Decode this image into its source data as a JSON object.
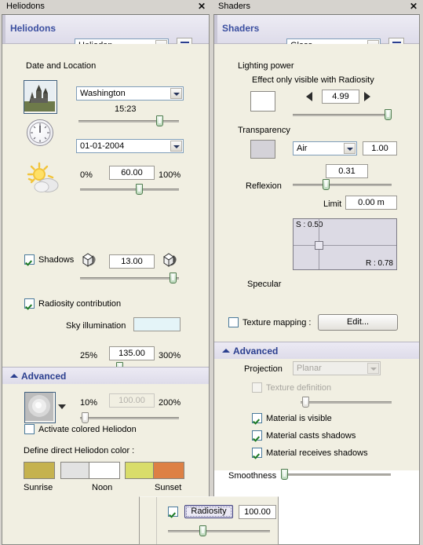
{
  "left_panel": {
    "title": "Heliodons",
    "close_label": "✕",
    "header_label": "Heliodons",
    "preset_combo_value": "Heliodon",
    "list_button_name": "list-view-button",
    "section_date_location": "Date and Location",
    "location_combo_value": "Washington",
    "time_value": "15:23",
    "date_combo_value": "01-01-2004",
    "sun_min_label": "0%",
    "sun_value": "60.00",
    "sun_max_label": "100%",
    "shadows_label": "Shadows",
    "shadows_value": "13.00",
    "radiosity_contribution_label": "Radiosity contribution",
    "sky_illumination_label": "Sky illumination",
    "sky_illumination_value": "",
    "sky_min_label": "25%",
    "sky_value": "135.00",
    "sky_max_label": "300%",
    "advanced_label": "Advanced",
    "adv_min_label": "10%",
    "adv_value": "100.00",
    "adv_max_label": "200%",
    "activate_colored_label": "Activate colored Heliodon",
    "define_color_label": "Define direct Heliodon color :",
    "swatches": [
      {
        "name": "sunrise",
        "color": "#c5b24e",
        "label": "Sunrise"
      },
      {
        "name": "mid-morning",
        "color": "#e2e2e2",
        "label": ""
      },
      {
        "name": "noon",
        "color": "#ffffff",
        "label": "Noon"
      },
      {
        "name": "afternoon",
        "color": "#d9dd6a",
        "label": ""
      },
      {
        "name": "sunset",
        "color": "#dd8044",
        "label": "Sunset"
      }
    ]
  },
  "right_panel": {
    "title": "Shaders",
    "close_label": "✕",
    "header_label": "Shaders",
    "shader_combo_value": "Glass",
    "lighting_power_label": "Lighting power",
    "lighting_hint_label": "Effect only visible with Radiosity",
    "lighting_color": "#ffffff",
    "lighting_value": "4.99",
    "transparency_label": "Transparency",
    "transparency_color": "#d4d2d8",
    "transparency_medium": "Air",
    "transparency_value": "1.00",
    "reflexion_label": "Reflexion",
    "reflexion_value": "0.31",
    "limit_label": "Limit",
    "limit_value": "0.00 m",
    "specular_label": "Specular",
    "specular_s_label": "S : 0.50",
    "specular_r_label": "R : 0.78",
    "texture_mapping_label": "Texture mapping :",
    "edit_button_label": "Edit...",
    "advanced_label": "Advanced",
    "projection_label": "Projection",
    "projection_value": "Planar",
    "texture_definition_label": "Texture definition",
    "material_visible_label": "Material is visible",
    "material_casts_label": "Material casts shadows",
    "material_receives_label": "Material receives shadows",
    "smoothness_label": "Smoothness"
  },
  "radiosity_popup": {
    "checkbox_checked": true,
    "button_label": "Radiosity",
    "value": "100.00"
  },
  "colors": {
    "accent_blue": "#2b3f8f",
    "panel_bg": "#f1efe2",
    "window_bg": "#d6d3ce",
    "slider_green": "#4c7a4c"
  }
}
